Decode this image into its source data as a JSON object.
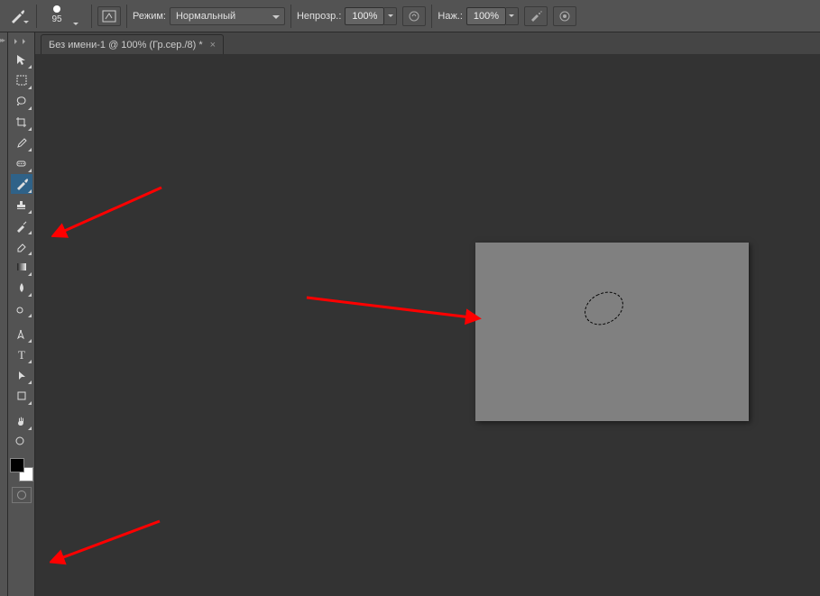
{
  "options": {
    "brush_size": "95",
    "mode_label": "Режим:",
    "mode_value": "Нормальный",
    "opacity_label": "Непрозр.:",
    "opacity_value": "100%",
    "flow_label": "Наж.:",
    "flow_value": "100%"
  },
  "tab": {
    "title": "Без имени-1 @ 100% (Гр.сер./8) *",
    "close": "×"
  },
  "tools": [
    {
      "name": "move-tool",
      "icon": "move",
      "tri": true
    },
    {
      "name": "marquee-tool",
      "icon": "marquee",
      "tri": true
    },
    {
      "name": "lasso-tool",
      "icon": "lasso",
      "tri": true
    },
    {
      "name": "crop-tool",
      "icon": "crop",
      "tri": true
    },
    {
      "name": "eyedropper-tool",
      "icon": "eye",
      "tri": true
    },
    {
      "name": "heal-tool",
      "icon": "heal",
      "tri": true
    },
    {
      "name": "brush-tool",
      "icon": "brush",
      "tri": true,
      "sel": true
    },
    {
      "name": "stamp-tool",
      "icon": "stamp",
      "tri": true
    },
    {
      "name": "history-brush-tool",
      "icon": "hist",
      "tri": true
    },
    {
      "name": "eraser-tool",
      "icon": "erase",
      "tri": true
    },
    {
      "name": "gradient-tool",
      "icon": "grad",
      "tri": true
    },
    {
      "name": "blur-tool",
      "icon": "blur",
      "tri": true
    },
    {
      "name": "dodge-tool",
      "icon": "dodge",
      "tri": true
    },
    {
      "name": "gap"
    },
    {
      "name": "pen-tool",
      "icon": "pen",
      "tri": true
    },
    {
      "name": "type-tool",
      "icon": "type",
      "tri": true
    },
    {
      "name": "path-select-tool",
      "icon": "pathsel",
      "tri": true
    },
    {
      "name": "shape-tool",
      "icon": "shape",
      "tri": true
    },
    {
      "name": "gap"
    },
    {
      "name": "hand-tool",
      "icon": "hand",
      "tri": true
    },
    {
      "name": "zoom-tool",
      "icon": "zoom",
      "tri": false
    }
  ]
}
